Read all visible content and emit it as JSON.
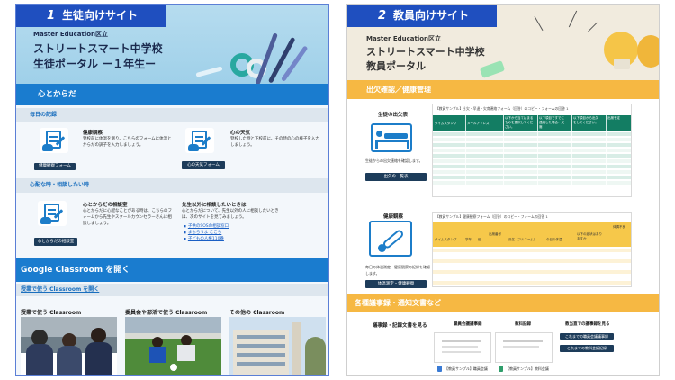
{
  "student": {
    "tag_num": "1",
    "tag_label": "生徒向けサイト",
    "school_small": "Master Education区立",
    "school_name": "ストリートスマート中学校",
    "portal_title": "生徒ポータル ー１年生ー",
    "section_heart": "心とからだ",
    "sub_daily": "毎日の記録",
    "health_title": "健康観察",
    "health_desc": "登校前に体温を測り、こちらのフォームに体温とからだの調子を入力しましょう。",
    "health_btn": "健康観察フォーム",
    "mood_title": "心の天気",
    "mood_desc": "登校した時と下校前に、その時の心の様子を入力しましょう。",
    "mood_btn": "心の天気フォーム",
    "sub_worry": "心配な時・相談したい時",
    "consult_title": "心とからだの相談室",
    "consult_desc": "心とからだに心配なことがある時は、こちらのフォームから先生やスクールカウンセラーさんに相談しましょう。",
    "consult_btn": "心とからだの相談室",
    "other_title": "先生以外に相談したいときは",
    "other_desc": "心とからだについて、先生以外の人に相談したいときは、次のサイトを見てみましょう。",
    "links": [
      "子供のSOSの相談窓口",
      "まもろうよ こころ",
      "子どもの人権110番"
    ],
    "section_classroom": "Google Classroom を開く",
    "sub_class": "授業で使う Classroom を開く",
    "card1": "授業で使う Classroom",
    "card2": "委員会や部活で使う Classroom",
    "card3": "その他の Classroom"
  },
  "teacher": {
    "tag_num": "2",
    "tag_label": "教員向けサイト",
    "school_small": "Master Education区立",
    "school_name": "ストリートスマート中学校",
    "portal_title": "教員ポータル",
    "section_attend": "出欠確認／健康管理",
    "attend_title": "生徒の出欠表",
    "attend_desc": "生徒からの出欠連絡を確認します。",
    "attend_btn": "出欠の一覧表",
    "sheet1_title": "【教員サンプル】出欠・早退・欠席連絡フォーム（回答）のコピー・フォームの回答 1",
    "sheet1_cols": [
      "タイムスタンプ",
      "メールアドレス",
      "以下から当てはまるものを選択してください。",
      "以下項目ですでに連絡した場合：欠席",
      "以下項目から出欠をしてください。",
      "出席予定"
    ],
    "health_title": "健康観察",
    "health_desc": "毎日の体温測定・健康観察の記録を確認します。",
    "health_btn": "体温測定・健康観察",
    "sheet2_title": "【教員サンプル】健康観察フォーム（回答）のコピー・フォームの回答 1",
    "sheet2_cols": [
      "タイムスタンプ",
      "学年",
      "組",
      "出席番号",
      "氏名（フルネーム）",
      "今日の体温",
      "以下の症状はありますか",
      "体調不良"
    ],
    "section_docs": "各種議事録・通知文書など",
    "docs_title": "議事録・記録文書を見る",
    "col1": "職員会議議事録",
    "col2": "教科記録",
    "col3": "教当直での議事録を見る",
    "doc1": "【教員サンプル】職員会議",
    "doc2": "【教員サンプル】教科会議",
    "btn_col3a": "これまでの職員会議議事録",
    "btn_col3b": "これまでの教科会議記録"
  },
  "colors": {
    "student_accent": "#1a7ccf",
    "teacher_accent": "#f6b843",
    "tag_blue": "#1f4fbf",
    "sheet_green": "#137d63",
    "sheet_yellow": "#f6c84a"
  }
}
